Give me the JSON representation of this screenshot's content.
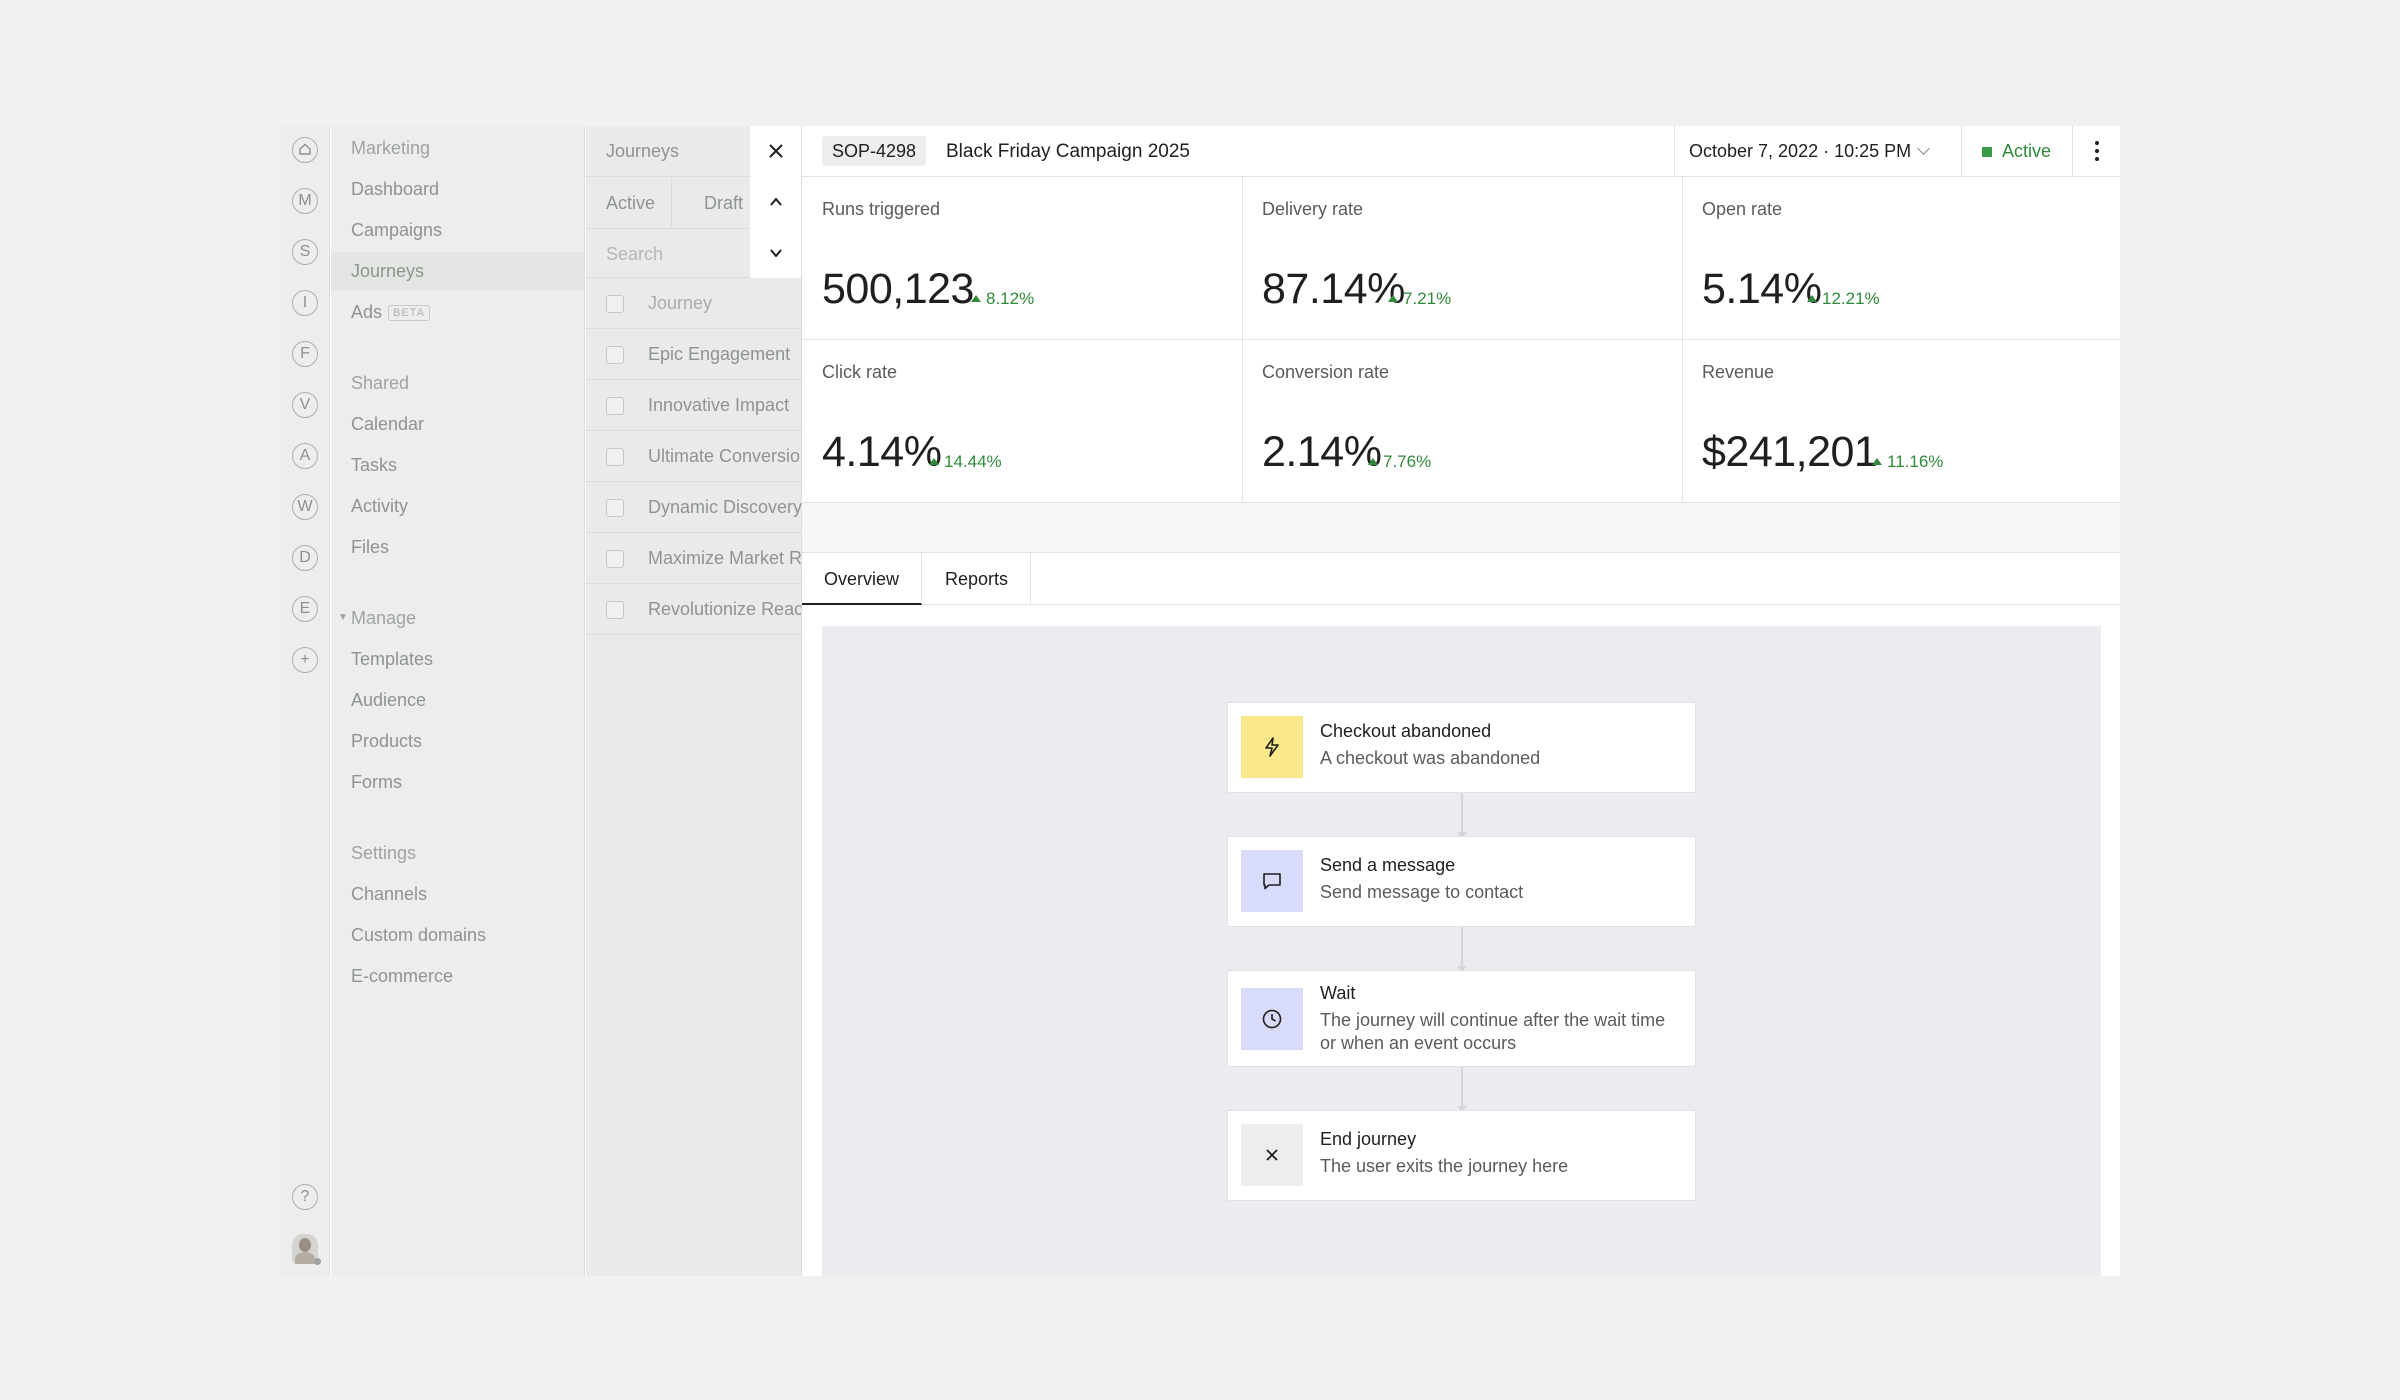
{
  "rail": {
    "icons": [
      "home-icon",
      "M",
      "S",
      "I",
      "F",
      "V",
      "A",
      "W",
      "D",
      "E",
      "+",
      "?"
    ]
  },
  "nav": {
    "marketing": "Marketing",
    "items_marketing": [
      "Dashboard",
      "Campaigns",
      "Journeys",
      "Ads"
    ],
    "ads_badge": "BETA",
    "shared": "Shared",
    "items_shared": [
      "Calendar",
      "Tasks",
      "Activity",
      "Files"
    ],
    "manage": "Manage",
    "items_manage": [
      "Templates",
      "Audience",
      "Products",
      "Forms"
    ],
    "settings": "Settings",
    "items_settings": [
      "Channels",
      "Custom domains",
      "E-commerce"
    ]
  },
  "list": {
    "title": "Journeys",
    "tabs": [
      "Active",
      "Draft"
    ],
    "search_placeholder": "Search",
    "column_header": "Journey",
    "rows": [
      "Epic Engagement",
      "Innovative Impact",
      "Ultimate Conversion",
      "Dynamic Discovery",
      "Maximize Market Reach",
      "Revolutionize Reach"
    ]
  },
  "panel": {
    "id_badge": "SOP-4298",
    "title": "Black Friday Campaign 2025",
    "date": "October 7, 2022 · 10:25 PM",
    "status": "Active",
    "status_color": "#3a9a45",
    "metrics": [
      {
        "label": "Runs triggered",
        "value": "500,123",
        "delta": "8.12%"
      },
      {
        "label": "Delivery rate",
        "value": "87.14%",
        "delta": "7.21%"
      },
      {
        "label": "Open rate",
        "value": "5.14%",
        "delta": "12.21%"
      },
      {
        "label": "Click rate",
        "value": "4.14%",
        "delta": "14.44%"
      },
      {
        "label": "Conversion rate",
        "value": "2.14%",
        "delta": "7.76%"
      },
      {
        "label": "Revenue",
        "value": "$241,201",
        "delta": "11.16%"
      }
    ],
    "tabs": [
      "Overview",
      "Reports"
    ],
    "active_tab": "Overview"
  },
  "flow": {
    "nodes": [
      {
        "title": "Checkout abandoned",
        "desc": "A checkout was abandoned",
        "icon": "lightning-icon",
        "icon_bg": "#fbe88a"
      },
      {
        "title": "Send a message",
        "desc": "Send message to contact",
        "icon": "message-icon",
        "icon_bg": "#d9dbfb"
      },
      {
        "title": "Wait",
        "desc": "The journey will continue after the wait time or when an event occurs",
        "icon": "clock-icon",
        "icon_bg": "#d9dbfb"
      },
      {
        "title": "End journey",
        "desc": "The user exits the journey here",
        "icon": "close-icon",
        "icon_bg": "#ededed"
      }
    ]
  }
}
